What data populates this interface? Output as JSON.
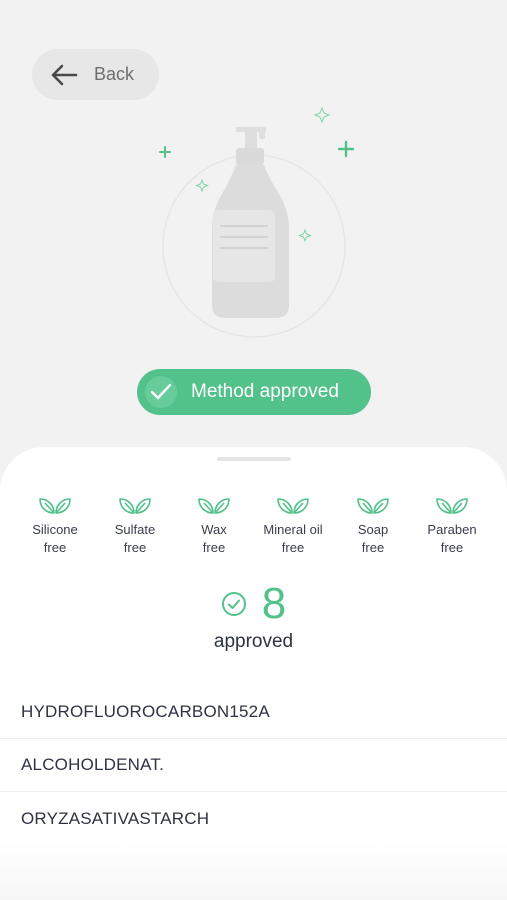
{
  "header": {
    "back_label": "Back"
  },
  "status": {
    "label": "Method approved",
    "color": "#52c18a"
  },
  "features": [
    {
      "label": "Silicone\nfree",
      "icon": "leaf-icon"
    },
    {
      "label": "Sulfate\nfree",
      "icon": "leaf-icon"
    },
    {
      "label": "Wax\nfree",
      "icon": "leaf-icon"
    },
    {
      "label": "Mineral oil\nfree",
      "icon": "leaf-icon"
    },
    {
      "label": "Soap\nfree",
      "icon": "leaf-icon"
    },
    {
      "label": "Paraben\nfree",
      "icon": "leaf-icon"
    }
  ],
  "summary": {
    "count": "8",
    "label": "approved"
  },
  "ingredients": [
    "HYDROFLUOROCARBON152A",
    "ALCOHOLDENAT.",
    "ORYZASATIVASTARCH"
  ]
}
